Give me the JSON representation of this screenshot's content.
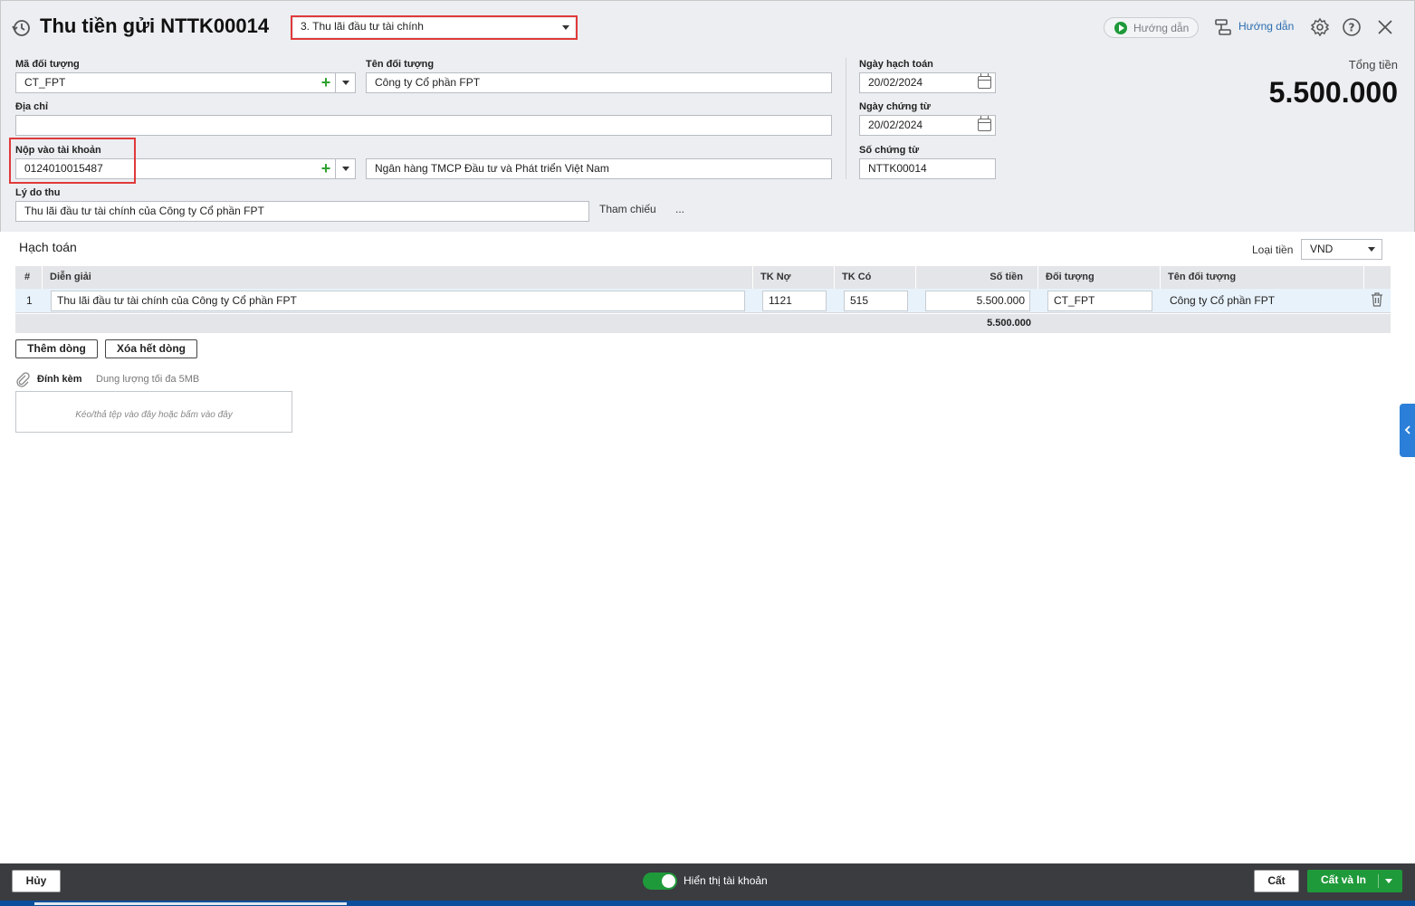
{
  "header": {
    "title": "Thu tiền gửi NTTK00014",
    "type_select": "3. Thu lãi đầu tư tài chính",
    "guide_video_label": "Hướng dẫn",
    "guide_label": "Hướng dẫn"
  },
  "form": {
    "ma_doi_tuong_label": "Mã đối tượng",
    "ma_doi_tuong": "CT_FPT",
    "ten_doi_tuong_label": "Tên đối tượng",
    "ten_doi_tuong": "Công ty Cổ phần FPT",
    "dia_chi_label": "Địa chỉ",
    "dia_chi": "",
    "nop_vao_tk_label": "Nộp vào tài khoản",
    "nop_vao_tk": "0124010015487",
    "ten_ngan_hang": "Ngân hàng TMCP Đầu tư và Phát triển Việt Nam",
    "ly_do_thu_label": "Lý do thu",
    "ly_do_thu": "Thu lãi đầu tư tài chính của Công ty Cổ phần FPT",
    "tham_chieu_label": "Tham chiếu",
    "tham_chieu_more": "...",
    "ngay_hach_toan_label": "Ngày hạch toán",
    "ngay_hach_toan": "20/02/2024",
    "ngay_chung_tu_label": "Ngày chứng từ",
    "ngay_chung_tu": "20/02/2024",
    "so_chung_tu_label": "Số chứng từ",
    "so_chung_tu": "NTTK00014",
    "tong_tien_label": "Tổng tiền",
    "tong_tien": "5.500.000"
  },
  "hach_toan": {
    "title": "Hạch toán",
    "currency_label": "Loại tiền",
    "currency": "VND",
    "columns": [
      "#",
      "Diễn giải",
      "TK Nợ",
      "TK Có",
      "Số tiền",
      "Đối tượng",
      "Tên đối tượng"
    ],
    "rows": [
      {
        "no": "1",
        "dien_giai": "Thu lãi đầu tư tài chính của Công ty Cổ phần FPT",
        "tk_no": "1121",
        "tk_co": "515",
        "so_tien": "5.500.000",
        "doi_tuong": "CT_FPT",
        "ten_doi_tuong": "Công ty Cổ phần FPT"
      }
    ],
    "total": "5.500.000",
    "add_row": "Thêm dòng",
    "clear_rows": "Xóa hết dòng"
  },
  "attach": {
    "label": "Đính kèm",
    "limit": "Dung lượng tối đa 5MB",
    "dropzone": "Kéo/thả tệp vào đây hoặc bấm vào đây"
  },
  "footer": {
    "cancel": "Hủy",
    "toggle_label": "Hiển thị tài khoản",
    "save": "Cất",
    "save_print": "Cất và In"
  },
  "colors": {
    "accent_green": "#1f9a3a",
    "highlight_red": "#e03a3a",
    "side_tab_blue": "#2b7fd8"
  }
}
